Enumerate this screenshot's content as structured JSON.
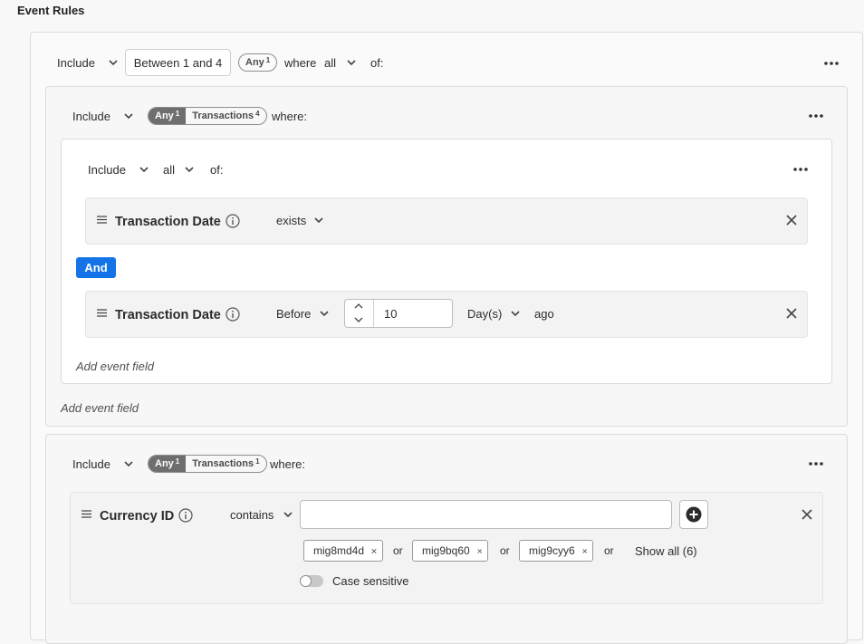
{
  "title": "Event Rules",
  "top_rule": {
    "mode": "Include",
    "count": "Between 1 and 4",
    "pill": {
      "any": "Any",
      "any_count": "1"
    },
    "where": "where",
    "quantifier": "all",
    "of": "of:"
  },
  "group1": {
    "mode": "Include",
    "pill": {
      "any": "Any",
      "any_count": "1",
      "event": "Transactions",
      "event_count": "4"
    },
    "where": "where:",
    "inner": {
      "mode": "Include",
      "quantifier": "all",
      "of": "of:",
      "row1": {
        "field": "Transaction Date",
        "operator": "exists"
      },
      "and_label": "And",
      "row2": {
        "field": "Transaction Date",
        "operator": "Before",
        "value": "10",
        "unit": "Day(s)",
        "suffix": "ago"
      },
      "add_field": "Add event field"
    },
    "add_field": "Add event field"
  },
  "group2": {
    "mode": "Include",
    "pill": {
      "any": "Any",
      "any_count": "1",
      "event": "Transactions",
      "event_count": "1"
    },
    "where": "where:",
    "row": {
      "field": "Currency ID",
      "operator": "contains",
      "input_value": "",
      "tags": [
        "mig8md4d",
        "mig9bq60",
        "mig9cyy6"
      ],
      "or_label": "or",
      "show_all": "Show all (6)",
      "case_sensitive": "Case sensitive",
      "case_sensitive_on": false
    }
  },
  "colors": {
    "and_button": "#1473e6",
    "background": "#f8f8f8",
    "panel": "#ffffff"
  }
}
